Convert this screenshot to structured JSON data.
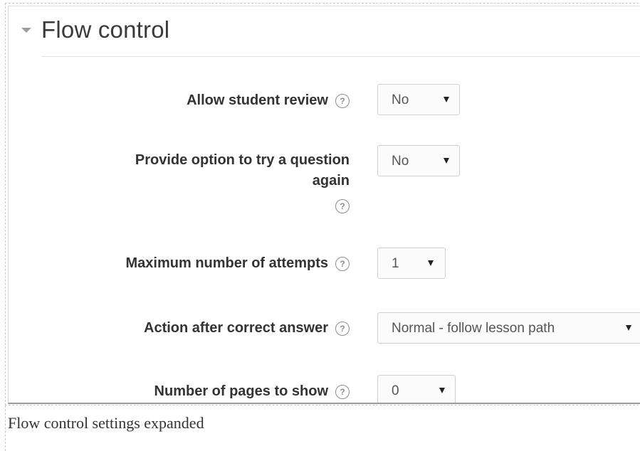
{
  "section": {
    "title": "Flow control",
    "collapse_icon": "chevron-down-icon"
  },
  "fields": [
    {
      "label": "Allow student review",
      "value": "No",
      "help_icon": "question-circle-icon"
    },
    {
      "label_line1": "Provide option to try a question",
      "label_line2": "again",
      "value": "No",
      "help_icon": "question-circle-icon"
    },
    {
      "label": "Maximum number of attempts",
      "value": "1",
      "help_icon": "question-circle-icon"
    },
    {
      "label": "Action after correct answer",
      "value": "Normal - follow lesson path",
      "help_icon": "question-circle-icon"
    },
    {
      "label": "Number of pages to show",
      "value": "0",
      "help_icon": "question-circle-icon"
    }
  ],
  "help_glyph": "?",
  "caption": "Flow control settings expanded"
}
